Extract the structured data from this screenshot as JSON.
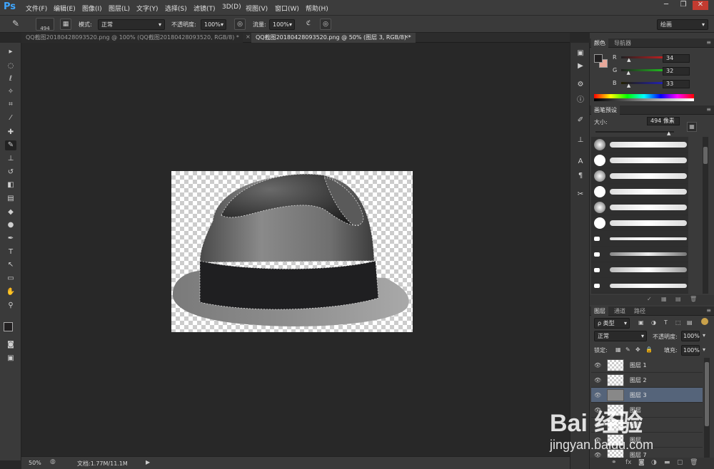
{
  "app": {
    "logo": "Ps"
  },
  "menu": [
    "文件(F)",
    "编辑(E)",
    "图像(I)",
    "图层(L)",
    "文字(Y)",
    "选择(S)",
    "滤镜(T)",
    "3D(D)",
    "视图(V)",
    "窗口(W)",
    "帮助(H)"
  ],
  "window_controls": {
    "minimize": "─",
    "restore": "❐",
    "close": "✕"
  },
  "options": {
    "brush_size": "494",
    "mode_label": "模式:",
    "mode_value": "正常",
    "opacity_label": "不透明度:",
    "opacity_value": "100%",
    "flow_label": "流量:",
    "flow_value": "100%",
    "workspace": "绘画"
  },
  "tabs": [
    {
      "label": "QQ截图20180428093520.png @ 100% (QQ截图20180428093520, RGB/8) *",
      "active": false
    },
    {
      "label": "QQ截图20180428093520.png @ 50% (图层 3, RGB/8) *",
      "active": true
    }
  ],
  "status": {
    "zoom": "50%",
    "doc_info": "文档:1.77M/11.1M"
  },
  "color_panel": {
    "tabs": [
      "颜色",
      "导航器"
    ],
    "r_label": "R",
    "r_value": "34",
    "g_label": "G",
    "g_value": "32",
    "b_label": "B",
    "b_value": "33",
    "r_fraction": 0.133,
    "g_fraction": 0.125,
    "b_fraction": 0.129,
    "foreground_color": "#222021",
    "background_color": "#e8a89a"
  },
  "brush_panel": {
    "tab": "画笔预设",
    "size_label": "大小:",
    "size_value": "494 像素"
  },
  "layers_panel": {
    "tabs": [
      "图层",
      "通道",
      "路径"
    ],
    "filter_label": "ρ 类型",
    "blend_mode": "正常",
    "opacity_label": "不透明度:",
    "opacity_value": "100%",
    "lock_label": "锁定:",
    "fill_label": "填充:",
    "fill_value": "100%",
    "layers": [
      {
        "name": "图层 1",
        "selected": false
      },
      {
        "name": "图层 2",
        "selected": false
      },
      {
        "name": "图层 3",
        "selected": true
      },
      {
        "name": "图层",
        "selected": false
      },
      {
        "name": "图层",
        "selected": false
      },
      {
        "name": "图层",
        "selected": false
      },
      {
        "name": "图层 7",
        "selected": false
      }
    ],
    "footer_icons": [
      "link-icon",
      "fx-icon",
      "mask-icon",
      "adjustment-icon",
      "group-icon",
      "new-layer-icon",
      "trash-icon"
    ]
  },
  "watermark": {
    "brand": "Bai 经验",
    "url": "jingyan.baidu.com"
  },
  "colors": {
    "accent": "#3fa6ff",
    "selected_layer": "#55647a",
    "ui_dark": "#282828",
    "panel": "#3a3a3a"
  }
}
